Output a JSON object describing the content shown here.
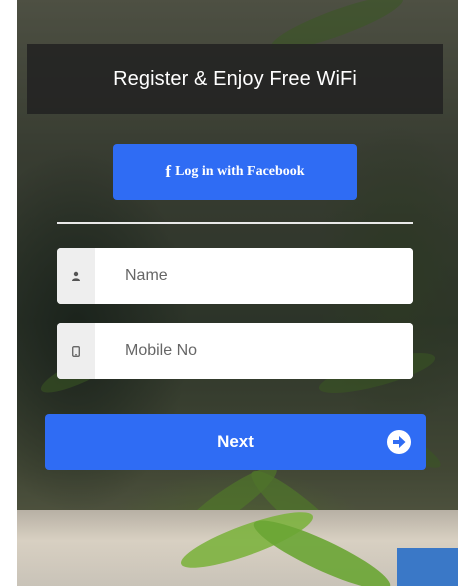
{
  "header": {
    "title": "Register & Enjoy Free WiFi"
  },
  "facebook": {
    "icon": "facebook-f-icon",
    "icon_glyph": "f",
    "label": "Log in with Facebook"
  },
  "form": {
    "name": {
      "icon": "user-icon",
      "placeholder": "Name",
      "value": ""
    },
    "mobile": {
      "icon": "mobile-phone-icon",
      "placeholder": "Mobile No",
      "value": ""
    }
  },
  "next": {
    "label": "Next",
    "icon": "arrow-right-circle-icon"
  },
  "colors": {
    "accent": "#2f6cf4",
    "header_bg": "#222222",
    "addon_bg": "#eeeeee"
  }
}
